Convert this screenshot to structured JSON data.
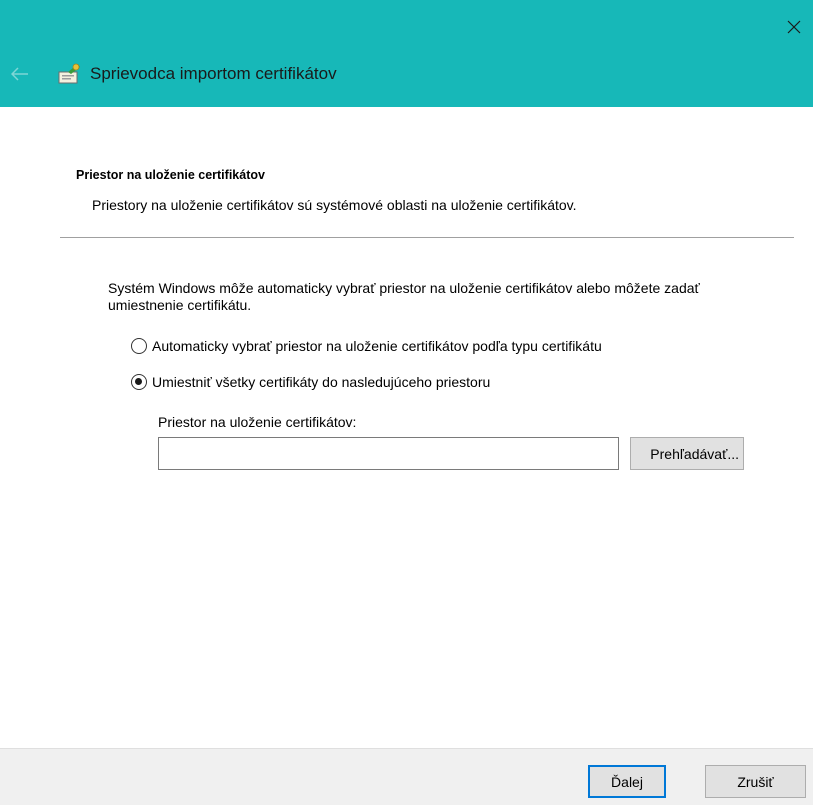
{
  "window": {
    "title": "Sprievodca importom certifikátov",
    "close_icon": "close-icon",
    "back_icon": "back-arrow-icon",
    "wizard_icon": "certificate-wizard-icon",
    "accent_color": "#17b8b8"
  },
  "page": {
    "heading": "Priestor na uloženie certifikátov",
    "description": "Priestory na uloženie certifikátov sú systémové oblasti na uloženie certifikátov.",
    "intro": "Systém Windows môže automaticky vybrať priestor na uloženie certifikátov alebo môžete zadať umiestnenie certifikátu.",
    "options": [
      {
        "label": "Automaticky vybrať priestor na uloženie certifikátov podľa typu certifikátu",
        "selected": false
      },
      {
        "label": "Umiestniť všetky certifikáty do nasledujúceho priestoru",
        "selected": true
      }
    ],
    "store_label": "Priestor na uloženie certifikátov:",
    "store_value": "",
    "browse_label": "Prehľadávať..."
  },
  "footer": {
    "next_label": "Ďalej",
    "cancel_label": "Zrušiť"
  }
}
